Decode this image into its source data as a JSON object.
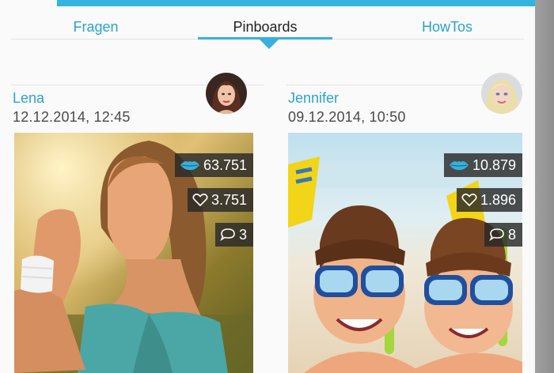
{
  "tabs": [
    {
      "label": "Fragen",
      "active": false
    },
    {
      "label": "Pinboards",
      "active": true
    },
    {
      "label": "HowTos",
      "active": false
    }
  ],
  "colors": {
    "accent": "#34b3df",
    "link": "#2aa3d1",
    "badge_bg": "#282828"
  },
  "posts": [
    {
      "author": "Lena",
      "timestamp": "12.12.2014, 12:45",
      "kisses": "63.751",
      "likes": "3.751",
      "comments": "3",
      "icons": [
        "lips-icon",
        "heart-icon",
        "comment-icon"
      ]
    },
    {
      "author": "Jennifer",
      "timestamp": "09.12.2014, 10:50",
      "kisses": "10.879",
      "likes": "1.896",
      "comments": "8",
      "icons": [
        "lips-icon",
        "heart-icon",
        "comment-icon"
      ]
    }
  ]
}
